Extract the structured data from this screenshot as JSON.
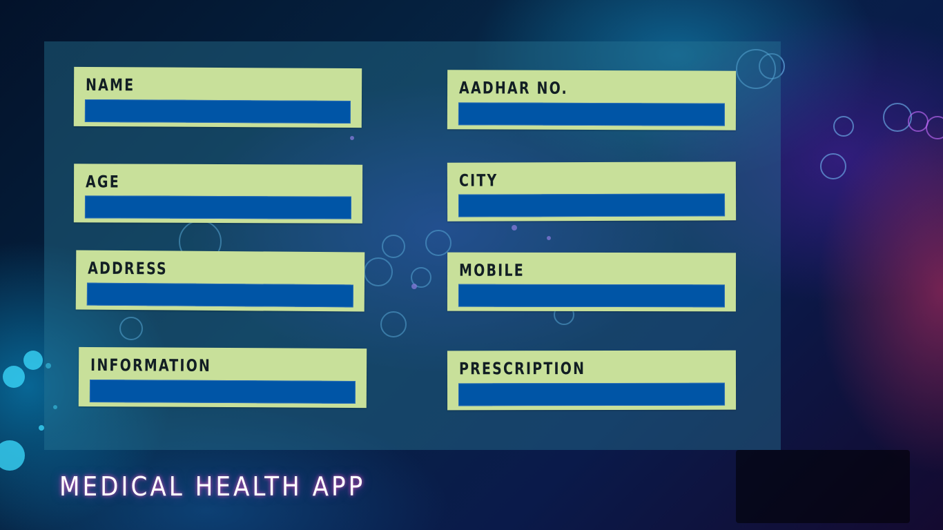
{
  "app": {
    "title": "MEDICAL HEALTH APP"
  },
  "form": {
    "fields": [
      {
        "id": "name",
        "label": "NAME",
        "value": ""
      },
      {
        "id": "aadhar",
        "label": "AADHAR NO.",
        "value": ""
      },
      {
        "id": "age",
        "label": "AGE",
        "value": ""
      },
      {
        "id": "city",
        "label": "CITY",
        "value": ""
      },
      {
        "id": "address",
        "label": "ADDRESS",
        "value": ""
      },
      {
        "id": "mobile",
        "label": "MOBILE",
        "value": ""
      },
      {
        "id": "information",
        "label": "INFORMATION",
        "value": ""
      },
      {
        "id": "prescription",
        "label": "PRESCRIPTION",
        "value": ""
      }
    ]
  },
  "colors": {
    "card": "#c8e09a",
    "field": "#0055a6",
    "label_text": "#121e24",
    "title_text": "#ffffff"
  }
}
